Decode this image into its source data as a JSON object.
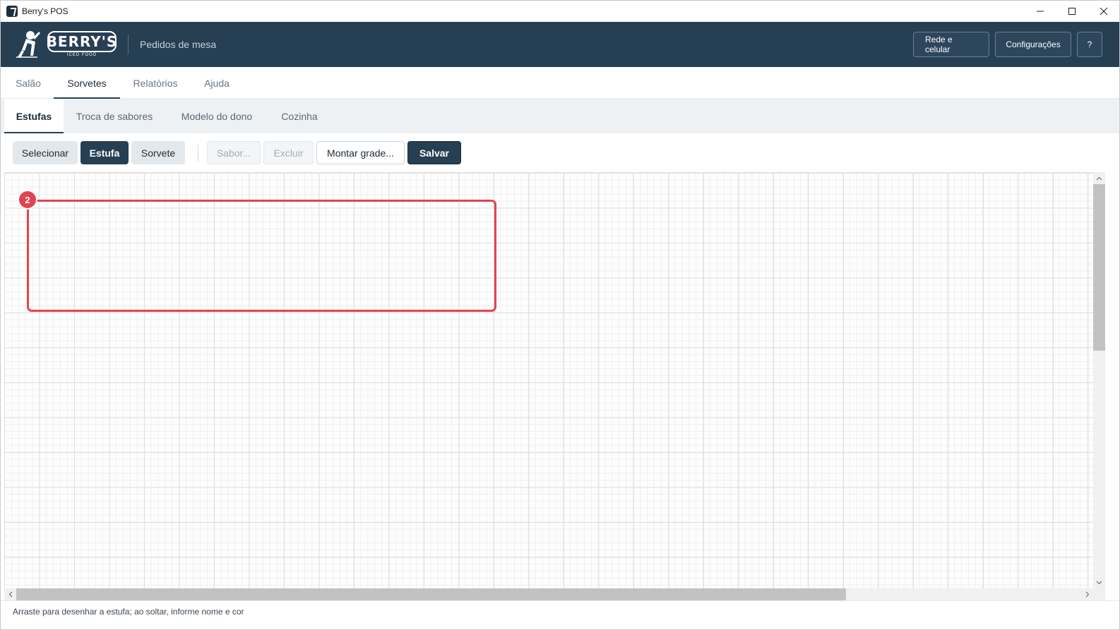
{
  "window": {
    "title": "Berry's POS"
  },
  "header": {
    "brand_name": "BERRY'S",
    "brand_sub": "ICED FOOD",
    "subtitle": "Pedidos de mesa",
    "buttons": {
      "network": "Rede e celular",
      "settings": "Configurações",
      "help": "?"
    }
  },
  "main_tabs": [
    {
      "label": "Salão",
      "active": false
    },
    {
      "label": "Sorvetes",
      "active": true
    },
    {
      "label": "Relatórios",
      "active": false
    },
    {
      "label": "Ajuda",
      "active": false
    }
  ],
  "sub_tabs": [
    {
      "label": "Estufas",
      "active": true
    },
    {
      "label": "Troca de sabores",
      "active": false
    },
    {
      "label": "Modelo do dono",
      "active": false
    },
    {
      "label": "Cozinha",
      "active": false
    }
  ],
  "toolbar": {
    "select": "Selecionar",
    "estufa": "Estufa",
    "sorvete": "Sorvete",
    "sabor": "Sabor...",
    "excluir": "Excluir",
    "montar_grade": "Montar grade...",
    "salvar": "Salvar",
    "active_tool": "Estufa"
  },
  "canvas": {
    "estufas": [
      {
        "number": "2",
        "color": "#e0454f"
      }
    ]
  },
  "status": {
    "text": "Arraste para desenhar a estufa; ao soltar, informe nome e cor"
  },
  "colors": {
    "header_bg": "#273f53",
    "accent": "#273f53",
    "estufa_red": "#e0454f"
  }
}
